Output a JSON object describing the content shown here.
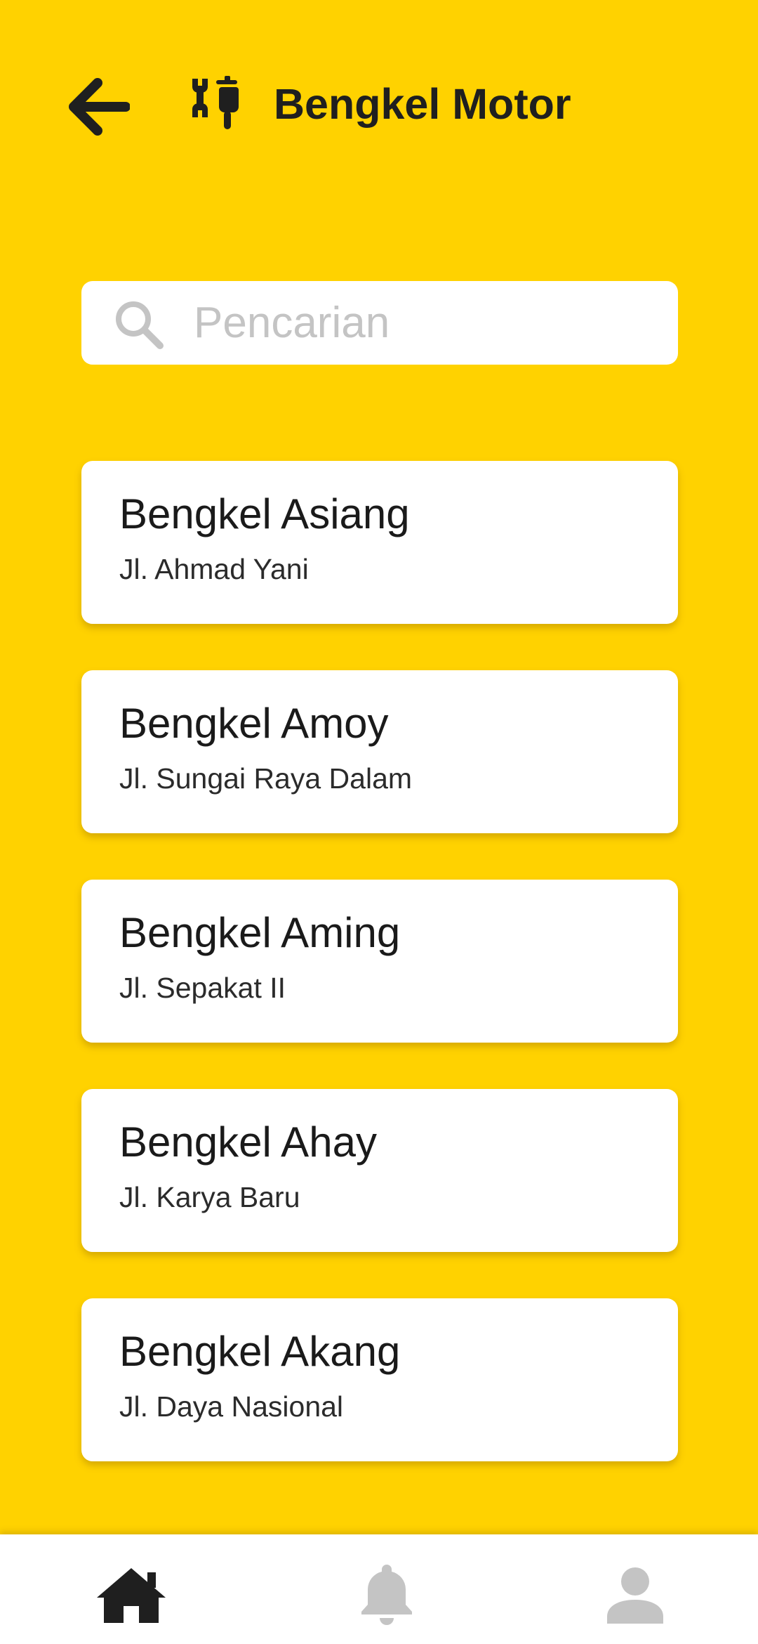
{
  "header": {
    "title": "Bengkel Motor",
    "back_icon": "arrow-left-icon",
    "app_icon": "wrench-scooter-icon"
  },
  "search": {
    "placeholder": "Pencarian",
    "value": "",
    "icon": "search-icon"
  },
  "workshops": [
    {
      "name": "Bengkel Asiang",
      "address": "Jl. Ahmad Yani"
    },
    {
      "name": "Bengkel Amoy",
      "address": "Jl. Sungai Raya Dalam"
    },
    {
      "name": "Bengkel Aming",
      "address": "Jl. Sepakat II"
    },
    {
      "name": "Bengkel Ahay",
      "address": "Jl. Karya Baru"
    },
    {
      "name": "Bengkel Akang",
      "address": "Jl. Daya Nasional"
    }
  ],
  "bottom_nav": {
    "items": [
      {
        "icon": "home-icon",
        "active": true
      },
      {
        "icon": "bell-icon",
        "active": false
      },
      {
        "icon": "user-icon",
        "active": false
      }
    ]
  },
  "colors": {
    "background": "#FFD200",
    "card": "#FFFFFF",
    "text": "#1A1A1A",
    "inactive_icon": "#C4C4C4",
    "active_icon": "#1F1F1F"
  }
}
